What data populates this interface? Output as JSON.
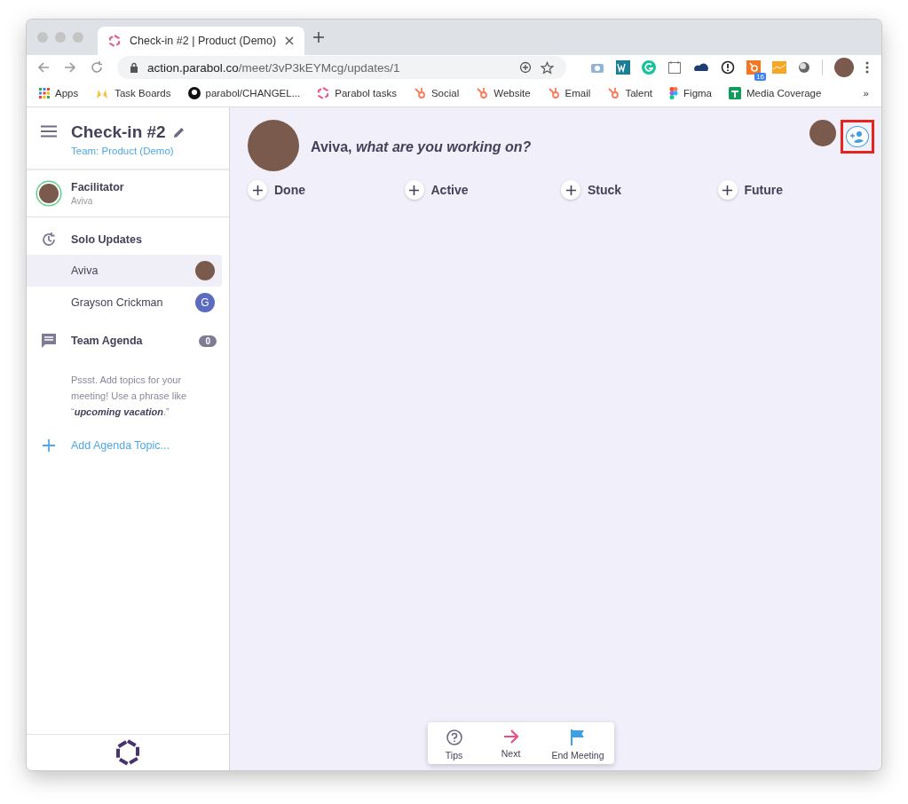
{
  "browser": {
    "tab_title": "Check-in #2 | Product (Demo)",
    "url_host": "action.parabol.co",
    "url_path": "/meet/3vP3kEYMcg/updates/1",
    "extension_badge": "16",
    "bookmarks": [
      {
        "label": "Apps",
        "kind": "apps"
      },
      {
        "label": "Task Boards",
        "kind": "hands"
      },
      {
        "label": "parabol/CHANGEL...",
        "kind": "github"
      },
      {
        "label": "Parabol tasks",
        "kind": "parabol"
      },
      {
        "label": "Social",
        "kind": "hubspot"
      },
      {
        "label": "Website",
        "kind": "hubspot"
      },
      {
        "label": "Email",
        "kind": "hubspot"
      },
      {
        "label": "Talent",
        "kind": "hubspot"
      },
      {
        "label": "Figma",
        "kind": "figma"
      },
      {
        "label": "Media Coverage",
        "kind": "sheets"
      }
    ],
    "more_bookmarks": "»"
  },
  "sidebar": {
    "title": "Check-in #2",
    "team": "Team: Product (Demo)",
    "facilitator": {
      "label": "Facilitator",
      "name": "Aviva"
    },
    "solo_updates": {
      "label": "Solo Updates",
      "members": [
        {
          "name": "Aviva",
          "selected": true,
          "kind": "photo"
        },
        {
          "name": "Grayson Crickman",
          "selected": false,
          "kind": "initial",
          "initial": "G"
        }
      ]
    },
    "agenda": {
      "label": "Team Agenda",
      "count": "0",
      "hint": "Pssst. Add topics for your meeting! Use a phrase like “**upcoming vacation**.”",
      "add_label": "Add Agenda Topic..."
    }
  },
  "main": {
    "prompt": "Aviva, *what are you working on?*",
    "invite_highlighted": true,
    "columns": [
      {
        "label": "Done"
      },
      {
        "label": "Active"
      },
      {
        "label": "Stuck"
      },
      {
        "label": "Future"
      }
    ],
    "controls": [
      {
        "label": "Tips",
        "kind": "tips"
      },
      {
        "label": "Next",
        "kind": "next"
      },
      {
        "label": "End Meeting",
        "kind": "end"
      }
    ]
  }
}
